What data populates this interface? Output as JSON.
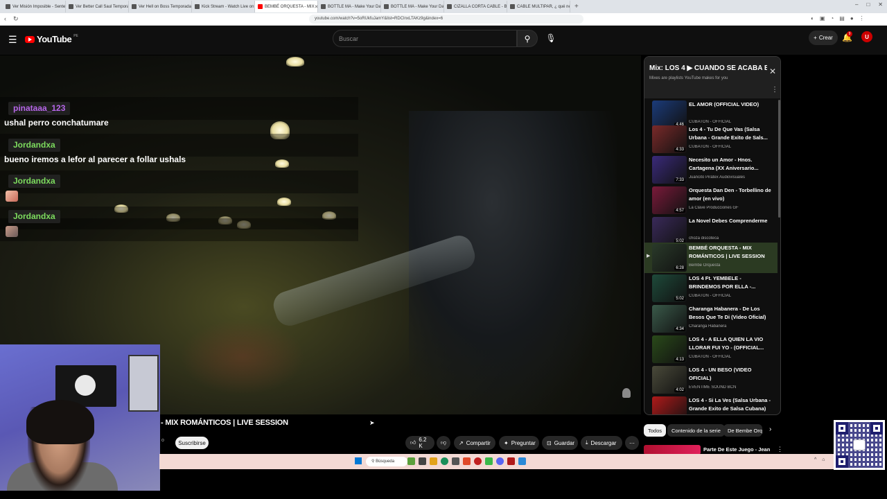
{
  "browser": {
    "tabs": [
      {
        "label": "Ver Misión Imposible - Sentencia fin"
      },
      {
        "label": "Ver Better Call Saul Temporada 2 Ep"
      },
      {
        "label": "Ver Hell on Boss Temporada 2 Episo"
      },
      {
        "label": "Kick Stream - Watch Live on Kick"
      },
      {
        "label": "BEMBÉ ORQUESTA - MIX",
        "active": true
      },
      {
        "label": "BOTTLE MA - Make Your Day"
      },
      {
        "label": "BOTTLE MA - Make Your Day"
      },
      {
        "label": "CIZALLA CORTA CABLE - Buscar con"
      },
      {
        "label": "CABLE MULTIPAR, ¿ qué necesitas s"
      }
    ],
    "url": "youtube.com/watch?v=5oRUkfuJamY&list=RDCInxLTAKz9g&index=6",
    "new_tab": "+"
  },
  "youtube": {
    "logo_text": "YouTube",
    "country": "PE",
    "search_placeholder": "Buscar",
    "create_label": "Crear",
    "notif_count": "9",
    "avatar_letter": "U"
  },
  "chat": [
    {
      "name": "pinataaa_123",
      "color": "#b666e8",
      "message": "ushal perro conchatumare"
    },
    {
      "name": "Jordandxa",
      "color": "#7ddc5e",
      "message": "bueno iremos a lefor al parecer a follar ushals"
    },
    {
      "name": "Jordandxa",
      "color": "#7ddc5e",
      "message": ""
    },
    {
      "name": "Jordandxa",
      "color": "#7ddc5e",
      "message": ""
    }
  ],
  "video": {
    "title_fragment": "- MIX ROMÁNTICOS | LIVE SESSION",
    "channel_fragment": "o",
    "subscribe_label": "Suscribirse",
    "likes": "6.2 K",
    "share_label": "Compartir",
    "ask_label": "Preguntar",
    "save_label": "Guardar",
    "download_label": "Descargar"
  },
  "playlist": {
    "title": "Mix: LOS 4 ▶ CUANDO SE ACABA E...",
    "subtitle": "Mixes are playlists YouTube makes for you",
    "items": [
      {
        "title": "EL AMOR (OFFICIAL VIDEO)",
        "channel": "CUBATON - OFFICIAL",
        "duration": "4:46",
        "thumb": "#1b3b7a"
      },
      {
        "title": "Los 4 - Tu De Que Vas (Salsa Urbana - Grande Exito de Sals...",
        "channel": "CUBATON - OFFICIAL",
        "duration": "4:33",
        "thumb": "#7a2a2a"
      },
      {
        "title": "Necesito un Amor - Hnos. Cartagena (XX Aniversario...",
        "channel": "Juancito Piratex Audiovisuales",
        "duration": "7:33",
        "thumb": "#3a2a7a"
      },
      {
        "title": "Orquesta Dan Den - Torbellino de amor (en vivo)",
        "channel": "La Clave Producciones GF",
        "duration": "4:57",
        "thumb": "#7a1a3a"
      },
      {
        "title": "La Novel Debes Comprenderme",
        "channel": "choza discoteca",
        "duration": "5:02",
        "thumb": "#3a2a5a"
      },
      {
        "title": "BEMBÉ ORQUESTA - MIX ROMÁNTICOS | LIVE SESSION",
        "channel": "Bembe Orquesta",
        "duration": "6:28",
        "thumb": "#2a3a2a",
        "current": true
      },
      {
        "title": "LOS 4 Ft. YEMBELE - BRINDEMOS POR ELLA -...",
        "channel": "CUBATON - OFFICIAL",
        "duration": "5:02",
        "thumb": "#1e4a3a"
      },
      {
        "title": "Charanga Habanera - De Los Besos Que Te Di (Video Oficial)",
        "channel": "Charanga Habanera",
        "duration": "4:34",
        "thumb": "#3a5a4a"
      },
      {
        "title": "LOS 4 - A ELLA QUIEN LA VIO LLORAR FUI YO - (OFFICIAL...",
        "channel": "CUBATON - OFFICIAL",
        "duration": "4:13",
        "thumb": "#2a4a1a"
      },
      {
        "title": "LOS 4 - UN BESO (VIDEO OFICIAL)",
        "channel": "EVENTIME SOUND BCN",
        "duration": "4:02",
        "thumb": "#4a4a3a"
      },
      {
        "title": "LOS 4 - Si La Ves (Salsa Urbana - Grande Exito de Salsa Cubana)",
        "channel": "",
        "duration": "",
        "thumb": "#b01a1a"
      }
    ]
  },
  "chips": [
    {
      "label": "Todos",
      "active": true
    },
    {
      "label": "Contenido de la serie"
    },
    {
      "label": "De Bembe Orqu"
    }
  ],
  "next_video": {
    "title": "Parte De Este Juego - Jean"
  },
  "taskbar": {
    "search_label": "Búsqueda"
  },
  "colors": {
    "youtube_red": "#ff0000",
    "bg": "#0f0f0f",
    "taskbar": "#f3d9d4"
  }
}
